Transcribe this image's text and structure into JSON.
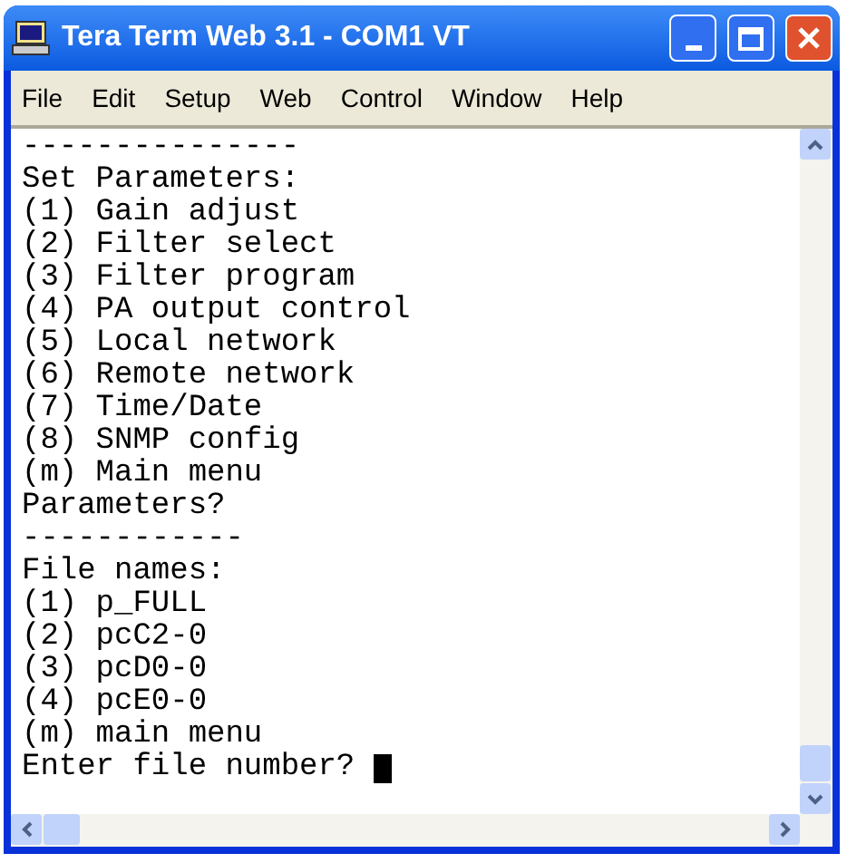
{
  "window": {
    "title": "Tera Term Web 3.1 - COM1 VT"
  },
  "menu": [
    "File",
    "Edit",
    "Setup",
    "Web",
    "Control",
    "Window",
    "Help"
  ],
  "terminal": {
    "lines": [
      "---------------",
      "Set Parameters:",
      "(1) Gain adjust",
      "(2) Filter select",
      "(3) Filter program",
      "(4) PA output control",
      "(5) Local network",
      "(6) Remote network",
      "(7) Time/Date",
      "(8) SNMP config",
      "(m) Main menu",
      "Parameters?",
      "------------",
      "File names:",
      "(1) p_FULL",
      "(2) pcC2-0",
      "(3) pcD0-0",
      "(4) pcE0-0",
      "(m) main menu",
      "Enter file number? "
    ],
    "cursor": true
  }
}
